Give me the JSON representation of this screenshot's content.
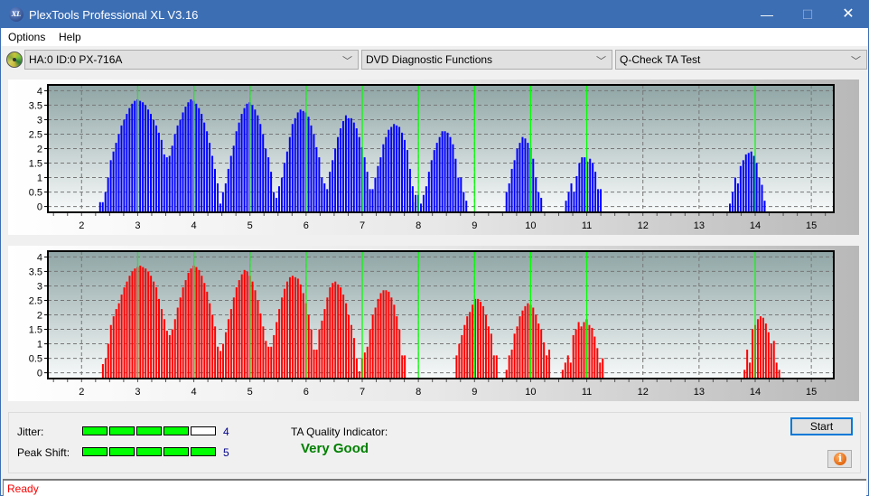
{
  "window": {
    "title": "PlexTools Professional XL V3.16",
    "app_icon_text": "XL",
    "minimize_glyph": "—",
    "maximize_glyph": "☐",
    "close_glyph": "✕"
  },
  "menu": {
    "items": [
      {
        "label": "Options"
      },
      {
        "label": "Help"
      }
    ]
  },
  "toolbar": {
    "drive": {
      "icon": "disc-drive-icon",
      "value": "HA:0 ID:0  PX-716A"
    },
    "function": {
      "value": "DVD Diagnostic Functions"
    },
    "test": {
      "value": "Q-Check TA Test"
    },
    "dropdown_glyph": "﹀"
  },
  "results": {
    "jitter_label": "Jitter:",
    "jitter_value": "4",
    "jitter_level": 4,
    "peak_shift_label": "Peak Shift:",
    "peak_shift_value": "5",
    "peak_shift_level": 5,
    "meter_max": 5,
    "ta_quality_label": "TA Quality Indicator:",
    "ta_quality_value": "Very Good",
    "start_label": "Start",
    "info_glyph": "i"
  },
  "status": {
    "text": "Ready"
  },
  "colors": {
    "accent": "#3c6eb4",
    "land_bars": "#0000ff",
    "pit_bars": "#ff0000",
    "reference_lines": "#00ff00",
    "meter_on": "#00ff00",
    "quality_text": "#008000",
    "status_text": "#ff0000"
  },
  "chart_data": [
    {
      "type": "bar",
      "title": "",
      "series_name": "Land (upper)",
      "xlabel": "",
      "ylabel": "",
      "xlim": [
        1.4,
        15.4
      ],
      "ylim": [
        -0.2,
        4.2
      ],
      "xticks": [
        2,
        3,
        4,
        5,
        6,
        7,
        8,
        9,
        10,
        11,
        12,
        13,
        14,
        15
      ],
      "yticks": [
        0,
        0.5,
        1,
        1.5,
        2,
        2.5,
        3,
        3.5,
        4
      ],
      "ytick_labels": [
        "0",
        "0.5",
        "1",
        "1.5",
        "2",
        "2.5",
        "3",
        "3.5",
        "4"
      ],
      "grid": true,
      "reference_lines_x": [
        3,
        4,
        5,
        6,
        7,
        8,
        9,
        10,
        11,
        14
      ],
      "bar_step": 0.0476,
      "clusters": [
        {
          "start": 2.33,
          "values": [
            0.15,
            0.15,
            0.5,
            1.0,
            1.6,
            1.9,
            2.2,
            2.5,
            2.8,
            3.0,
            3.2,
            3.4,
            3.55,
            3.65,
            3.7,
            3.65,
            3.6,
            3.5,
            3.35,
            3.2,
            3.0,
            2.8,
            2.55,
            2.3,
            1.8,
            1.7,
            1.75,
            2.1,
            2.5,
            2.8,
            3.0,
            3.25,
            3.45,
            3.6,
            3.7,
            3.65,
            3.55,
            3.4,
            3.2,
            2.9,
            2.6,
            2.2,
            1.75,
            1.3,
            0.8,
            0.1,
            0.5,
            0.8,
            1.3,
            1.75,
            2.1,
            2.6,
            2.9,
            3.2,
            3.4,
            3.55,
            3.6,
            3.5,
            3.35,
            3.15,
            2.85,
            2.5,
            2.0,
            1.7,
            1.2,
            0.5,
            0.3,
            0.7,
            1.0,
            1.5,
            1.9,
            2.4,
            2.85,
            3.05,
            3.25,
            3.35,
            3.3,
            3.25,
            3.1,
            2.8,
            2.5,
            2.05,
            1.7,
            1.0,
            0.8,
            0.6,
            1.2,
            1.6,
            2.0,
            2.4,
            2.7,
            2.95,
            3.15,
            3.05,
            3.05,
            2.9,
            2.7,
            2.4,
            2.05,
            1.7,
            1.2,
            0.6,
            0.6,
            1.0,
            1.4,
            1.7,
            2.15,
            2.4,
            2.65,
            2.75,
            2.85,
            2.8,
            2.75,
            2.55,
            2.3,
            1.95,
            1.3,
            0.7,
            0.15
          ]
        },
        {
          "start": 7.95,
          "values": [
            0.4,
            0.4,
            0.1,
            0.4,
            0.7,
            1.2,
            1.6,
            1.95,
            2.2,
            2.4,
            2.6,
            2.6,
            2.55,
            2.4,
            2.15,
            1.65,
            1.0,
            1.0,
            0.5,
            0.2
          ]
        },
        {
          "start": 9.57,
          "values": [
            0.5,
            0.8,
            1.3,
            1.6,
            2.0,
            2.2,
            2.4,
            2.35,
            2.2,
            2.0,
            1.65,
            1.0,
            0.5,
            0.3
          ]
        },
        {
          "start": 10.63,
          "values": [
            0.2,
            0.5,
            0.8,
            0.5,
            1.05,
            1.5,
            1.7,
            1.7,
            1.55,
            1.65,
            1.5,
            1.2,
            0.6,
            0.6
          ]
        },
        {
          "start": 13.55,
          "values": [
            0.1,
            0.5,
            1.0,
            0.8,
            1.4,
            1.6,
            1.8,
            1.85,
            1.9,
            1.75,
            1.5,
            1.0,
            0.75,
            0.2
          ]
        }
      ]
    },
    {
      "type": "bar",
      "title": "",
      "series_name": "Pit (lower)",
      "xlabel": "",
      "ylabel": "",
      "xlim": [
        1.4,
        15.4
      ],
      "ylim": [
        -0.2,
        4.2
      ],
      "xticks": [
        2,
        3,
        4,
        5,
        6,
        7,
        8,
        9,
        10,
        11,
        12,
        13,
        14,
        15
      ],
      "yticks": [
        0,
        0.5,
        1,
        1.5,
        2,
        2.5,
        3,
        3.5,
        4
      ],
      "ytick_labels": [
        "0",
        "0.5",
        "1",
        "1.5",
        "2",
        "2.5",
        "3",
        "3.5",
        "4"
      ],
      "grid": true,
      "reference_lines_x": [
        3,
        4,
        5,
        6,
        7,
        8,
        9,
        10,
        11,
        14
      ],
      "bar_step": 0.0476,
      "clusters": [
        {
          "start": 2.38,
          "values": [
            0.3,
            0.5,
            1.0,
            1.65,
            1.95,
            2.2,
            2.4,
            2.7,
            2.95,
            3.15,
            3.35,
            3.5,
            3.6,
            3.65,
            3.7,
            3.65,
            3.6,
            3.5,
            3.35,
            3.15,
            2.95,
            2.55,
            2.2,
            1.85,
            1.45,
            1.3,
            1.5,
            1.85,
            2.25,
            2.6,
            2.95,
            3.2,
            3.45,
            3.6,
            3.7,
            3.65,
            3.55,
            3.35,
            3.1,
            2.8,
            2.4,
            2.0,
            1.6,
            0.9,
            0.75,
            1.0,
            1.4,
            1.85,
            2.2,
            2.6,
            2.95,
            3.2,
            3.4,
            3.55,
            3.5,
            3.35,
            3.15,
            2.85,
            2.5,
            2.05,
            1.6,
            1.1,
            0.9,
            0.9,
            1.3,
            1.75,
            2.2,
            2.6,
            2.9,
            3.15,
            3.3,
            3.35,
            3.3,
            3.25,
            3.05,
            2.75,
            2.4,
            2.0,
            1.5,
            0.8,
            0.8,
            1.5,
            1.8,
            2.2,
            2.6,
            2.95,
            3.1,
            3.15,
            3.05,
            2.95,
            2.7,
            2.4,
            2.0,
            1.65,
            1.2,
            0.5,
            0.05,
            0.5,
            0.7,
            0.9,
            1.5,
            2.0,
            2.25,
            2.55,
            2.75,
            2.85,
            2.85,
            2.8,
            2.6,
            2.35,
            1.95,
            1.5,
            0.6,
            0.6
          ]
        },
        {
          "start": 8.68,
          "values": [
            0.6,
            1.0,
            1.3,
            1.65,
            1.95,
            2.1,
            2.35,
            2.55,
            2.55,
            2.45,
            2.3,
            2.0,
            1.6,
            1.35,
            0.6,
            0.6
          ]
        },
        {
          "start": 9.57,
          "values": [
            0.1,
            0.6,
            0.8,
            1.35,
            1.6,
            1.95,
            2.15,
            2.3,
            2.4,
            2.35,
            2.25,
            2.0,
            1.7,
            1.5,
            1.05,
            0.6,
            0.8
          ]
        },
        {
          "start": 10.57,
          "values": [
            0.1,
            0.35,
            0.6,
            0.35,
            1.3,
            1.5,
            1.75,
            1.6,
            1.75,
            1.85,
            1.65,
            1.55,
            1.25,
            0.85,
            0.35,
            0.5
          ]
        },
        {
          "start": 13.81,
          "values": [
            0.1,
            0.8,
            0.35,
            1.5,
            1.65,
            1.85,
            1.95,
            1.9,
            1.7,
            1.4,
            1.0,
            1.1,
            0.35,
            0.1
          ]
        }
      ]
    }
  ]
}
